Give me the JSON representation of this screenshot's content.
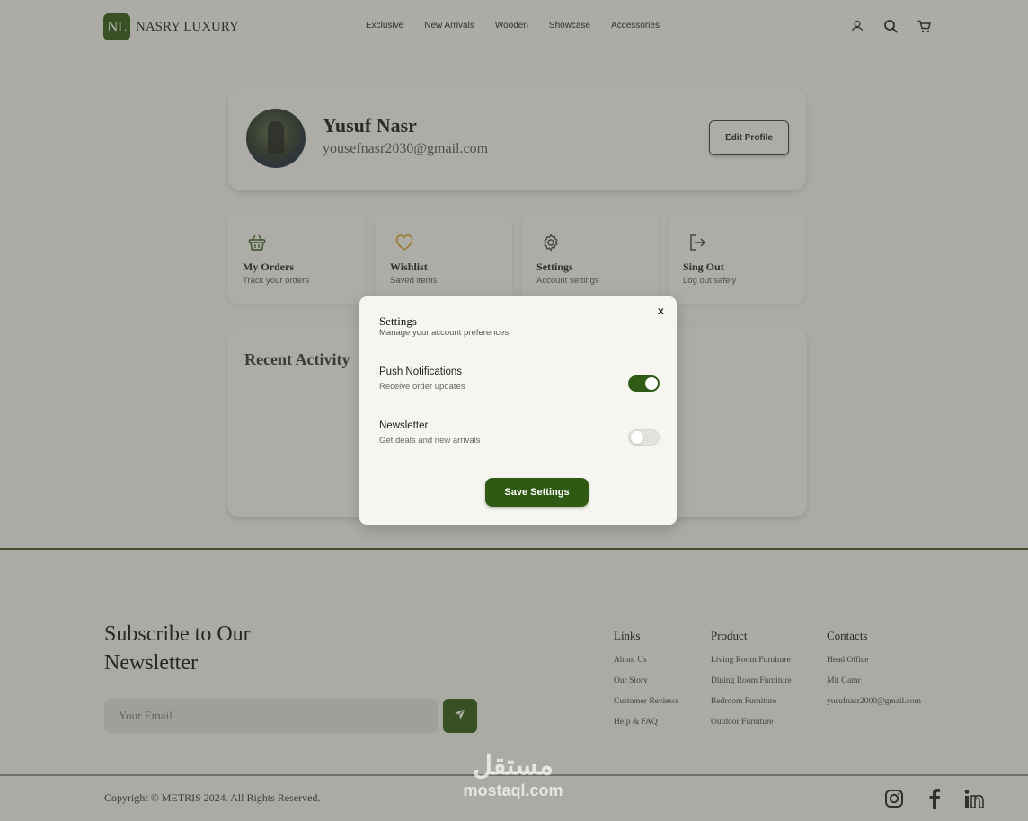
{
  "brand": {
    "logo_initials": "NL",
    "name": "NASRY LUXURY",
    "accent": "#2f5a14"
  },
  "nav": {
    "items": [
      "Exclusive",
      "New Arrivals",
      "Wooden",
      "Showcase",
      "Accessories"
    ]
  },
  "header_icons": [
    "user-icon",
    "search-icon",
    "cart-icon"
  ],
  "profile": {
    "name": "Yusuf Nasr",
    "email": "yousefnasr2030@gmail.com",
    "edit_label": "Edit Profile"
  },
  "quick_cards": [
    {
      "icon": "basket-icon",
      "title": "My Orders",
      "subtitle": "Track your orders"
    },
    {
      "icon": "heart-icon",
      "title": "Wishlist",
      "subtitle": "Saved items"
    },
    {
      "icon": "gear-icon",
      "title": "Settings",
      "subtitle": "Account settings"
    },
    {
      "icon": "logout-icon",
      "title": "Sing Out",
      "subtitle": "Log out safely"
    }
  ],
  "activity": {
    "title": "Recent Activity"
  },
  "settings_modal": {
    "close_label": "x",
    "title": "Settings",
    "subtitle": "Manage your account preferences",
    "options": [
      {
        "title": "Push Notifications",
        "subtitle": "Receive order updates",
        "enabled": true
      },
      {
        "title": "Newsletter",
        "subtitle": "Get deals and new arrivals",
        "enabled": false
      }
    ],
    "save_label": "Save Settings"
  },
  "footer": {
    "subscribe_title": "Subscribe to Our Newsletter",
    "email_placeholder": "Your Email",
    "columns": [
      {
        "heading": "Links",
        "items": [
          "About Us",
          "Our Story",
          "Customer Reviews",
          "Help & FAQ"
        ]
      },
      {
        "heading": "Product",
        "items": [
          "Living Room Furniture",
          "Dining Room Furniture",
          "Bedroom Furniture",
          "Outdoor Furniture"
        ]
      },
      {
        "heading": "Contacts",
        "items": [
          "Head Office",
          "Mit Gamr",
          "yusufnasr2000@gmail.com"
        ]
      }
    ],
    "copyright": "Copyright © METRIS 2024. All Rights Reserved.",
    "social": [
      "instagram-icon",
      "facebook-icon",
      "linkedin-icon"
    ]
  },
  "watermark": {
    "arabic": "مستقل",
    "latin": "mostaql.com"
  }
}
